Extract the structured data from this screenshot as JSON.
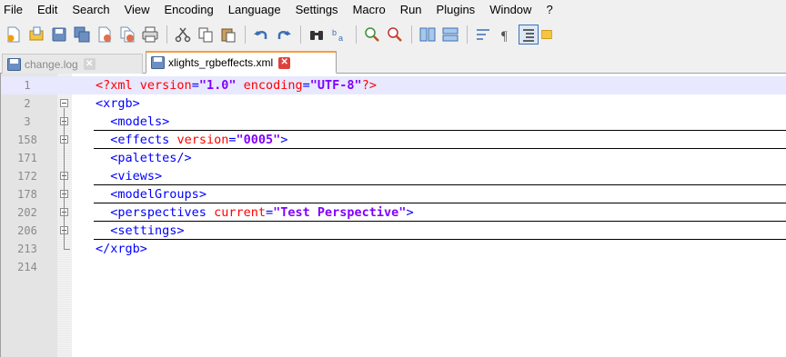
{
  "menu": [
    "File",
    "Edit",
    "Search",
    "View",
    "Encoding",
    "Language",
    "Settings",
    "Macro",
    "Run",
    "Plugins",
    "Window",
    "?"
  ],
  "toolbar": {
    "buttons": [
      "new-file-icon",
      "open-file-icon",
      "save-icon",
      "save-all-icon",
      "close-icon",
      "close-all-icon",
      "print-icon",
      "cut-icon",
      "copy-icon",
      "paste-icon",
      "undo-icon",
      "redo-icon",
      "find-icon",
      "replace-icon",
      "zoom-in-icon",
      "zoom-out-icon",
      "sync-vertical-icon",
      "sync-horizontal-icon",
      "word-wrap-icon",
      "show-all-chars-icon",
      "indent-guide-icon"
    ]
  },
  "tabs": [
    {
      "label": "change.log",
      "active": false
    },
    {
      "label": "xlights_rgbeffects.xml",
      "active": true
    }
  ],
  "editor": {
    "lines": [
      {
        "num": "1",
        "fold": "",
        "text": "<?xml version=\"1.0\" encoding=\"UTF-8\"?>"
      },
      {
        "num": "2",
        "fold": "minus",
        "text": "<xrgb>"
      },
      {
        "num": "3",
        "fold": "plus",
        "text": "  <models>"
      },
      {
        "num": "158",
        "fold": "plus",
        "text": "  <effects version=\"0005\">"
      },
      {
        "num": "171",
        "fold": "",
        "text": "  <palettes/>"
      },
      {
        "num": "172",
        "fold": "plus",
        "text": "  <views>"
      },
      {
        "num": "178",
        "fold": "plus",
        "text": "  <modelGroups>"
      },
      {
        "num": "202",
        "fold": "plus",
        "text": "  <perspectives current=\"Test Perspective\">"
      },
      {
        "num": "206",
        "fold": "plus",
        "text": "  <settings>"
      },
      {
        "num": "213",
        "fold": "end",
        "text": "</xrgb>"
      },
      {
        "num": "214",
        "fold": "",
        "text": ""
      }
    ]
  },
  "colors": {
    "tag": "#0000ff",
    "attribute": "#ff0000",
    "value": "#8000ff",
    "current_line": "#e8e8ff",
    "active_tab_accent": "#fa9b3c"
  }
}
